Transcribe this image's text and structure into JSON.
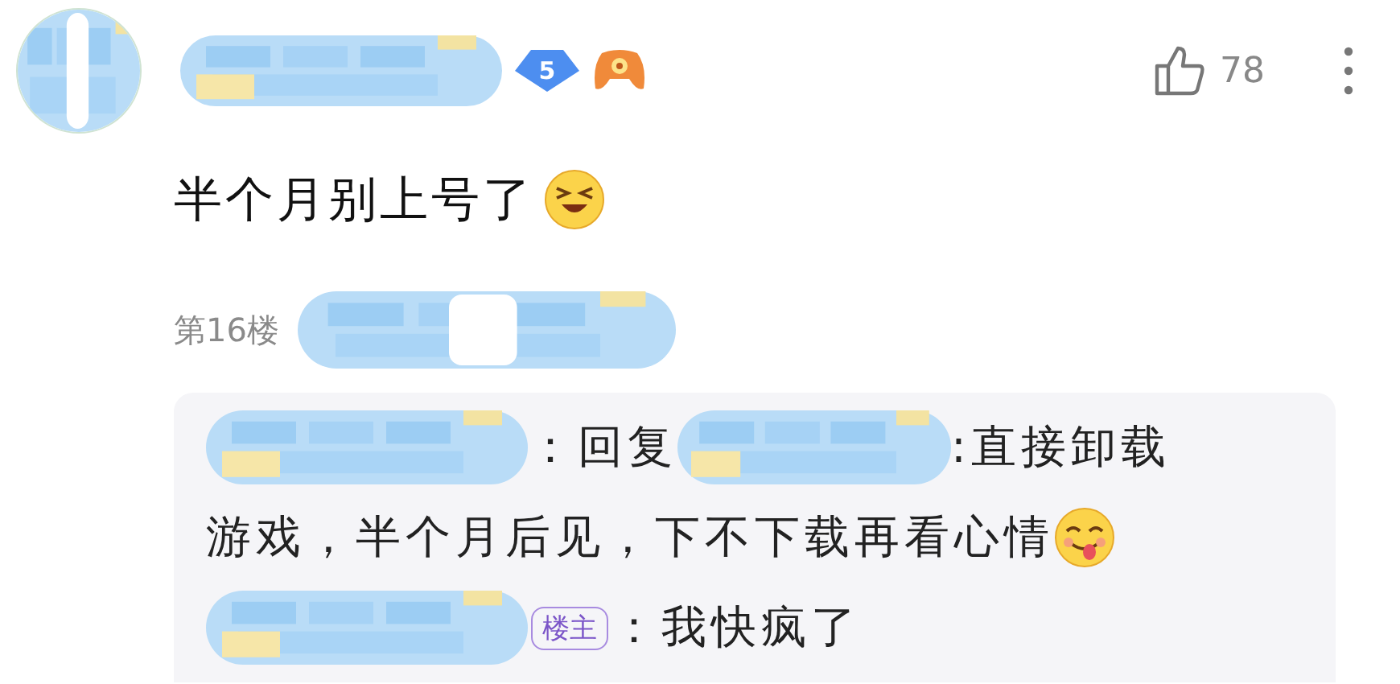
{
  "author": {
    "level": "5"
  },
  "likes": "78",
  "comment": {
    "text": "半个月别上号了"
  },
  "floor": "第16楼",
  "replies": [
    {
      "lines": [
        [
          {
            "kind": "picture"
          },
          {
            "kind": "text",
            "text": "：回复"
          },
          {
            "kind": "picture"
          },
          {
            "kind": "text",
            "text": ":直接卸载"
          }
        ],
        [
          {
            "kind": "text",
            "text": "游戏，半个月后见，下不下载再看心情"
          },
          {
            "kind": "emoji"
          }
        ]
      ]
    },
    {
      "lines": [
        [
          {
            "kind": "picture"
          },
          {
            "kind": "tag",
            "text": "楼主"
          },
          {
            "kind": "text",
            "text": "：我快疯了"
          }
        ]
      ]
    }
  ]
}
